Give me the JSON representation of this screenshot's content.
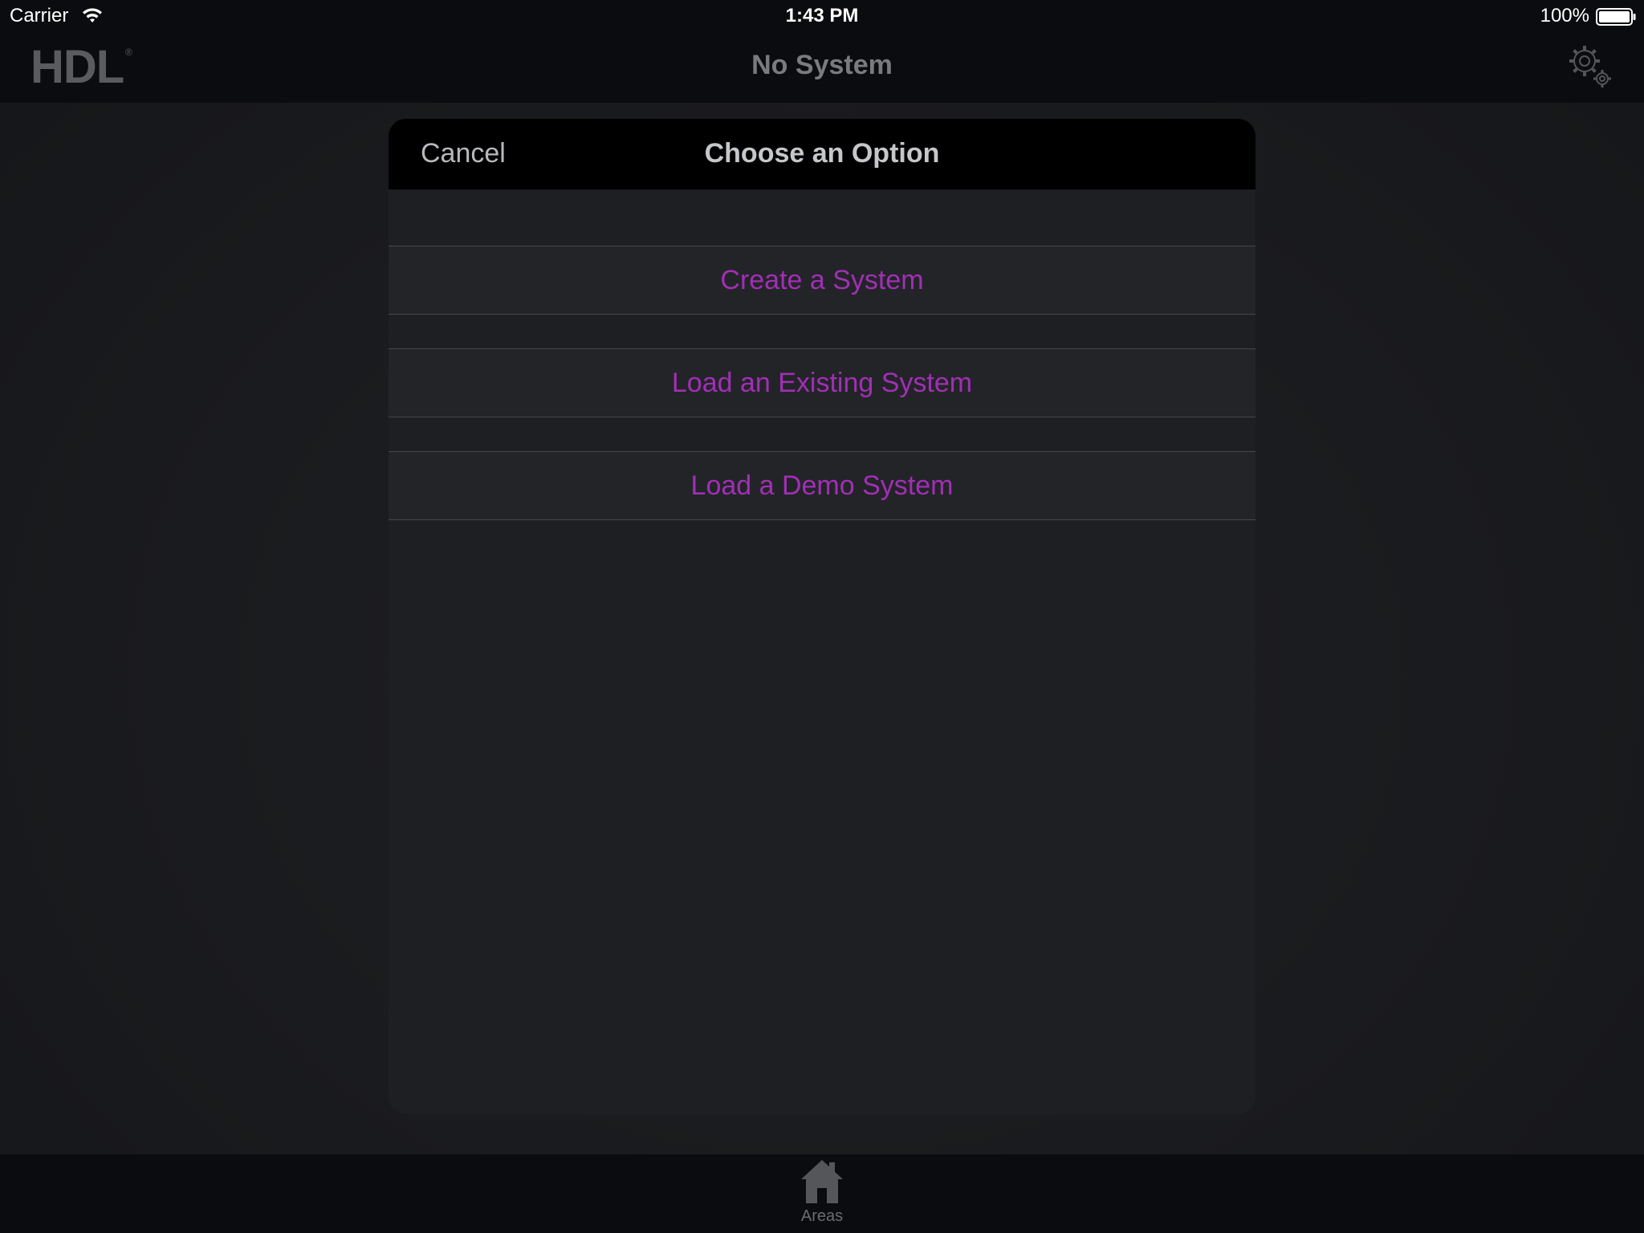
{
  "status_bar": {
    "carrier": "Carrier",
    "time": "1:43 PM",
    "battery": "100%"
  },
  "nav_bar": {
    "logo": "HDL",
    "logo_mark": "®",
    "title": "No System",
    "settings_icon": "gear-icon"
  },
  "modal": {
    "cancel_label": "Cancel",
    "title": "Choose an Option",
    "options": [
      {
        "label": "Create a System"
      },
      {
        "label": "Load an Existing System"
      },
      {
        "label": "Load a Demo System"
      }
    ]
  },
  "tab_bar": {
    "items": [
      {
        "label": "Areas",
        "icon": "home-icon"
      }
    ]
  },
  "colors": {
    "accent": "#a12fb5",
    "background": "#1a1b1e",
    "bar": "#0b0c0f",
    "modal_header": "#000000"
  }
}
